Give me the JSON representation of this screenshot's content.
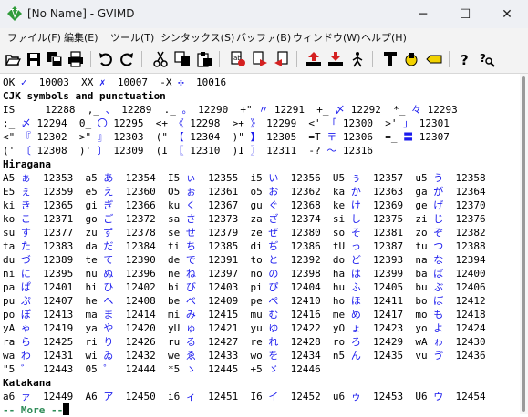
{
  "window": {
    "title": "[No Name] - GVIMD",
    "controls": {
      "minimize": "─",
      "maximize": "☐",
      "close": "✕"
    }
  },
  "menubar": {
    "items": [
      {
        "label": "ファイル(F)"
      },
      {
        "label": "編集(E)"
      },
      {
        "label": "ツール(T)"
      },
      {
        "label": "シンタックス(S)"
      },
      {
        "label": "バッファ(B)"
      },
      {
        "label": "ウィンドウ(W)"
      },
      {
        "label": "ヘルプ(H)"
      }
    ]
  },
  "toolbar": {
    "buttons": [
      {
        "icon": "open-icon"
      },
      {
        "icon": "save-icon"
      },
      {
        "icon": "save-all-icon"
      },
      {
        "icon": "print-icon"
      },
      {
        "icon": "undo-icon"
      },
      {
        "icon": "redo-icon"
      },
      {
        "icon": "cut-icon"
      },
      {
        "icon": "copy-icon"
      },
      {
        "icon": "paste-icon"
      },
      {
        "icon": "replace-icon"
      },
      {
        "icon": "find-next-icon"
      },
      {
        "icon": "find-prev-icon"
      },
      {
        "icon": "load-session-icon"
      },
      {
        "icon": "save-session-icon"
      },
      {
        "icon": "run-script-icon"
      },
      {
        "icon": "make-icon"
      },
      {
        "icon": "shell-icon"
      },
      {
        "icon": "tags-icon"
      },
      {
        "icon": "help-icon"
      },
      {
        "icon": "find-help-icon"
      }
    ]
  },
  "editor": {
    "lines": [
      {
        "kind": "data",
        "text": "OK ✓  10003  XX ✗  10007  -X ✣  10016"
      },
      {
        "kind": "header",
        "text": "CJK symbols and punctuation"
      },
      {
        "kind": "data",
        "text": "IS     12288  ,_ 、 12289  ._ 。 12290  +\" 〃 12291  +_ 〆 12292  *_ 々 12293"
      },
      {
        "kind": "data",
        "text": ";_ 〆 12294  0_ 〇 12295  <+ 《 12298  >+ 》 12299  <' 「 12300  >' 」 12301"
      },
      {
        "kind": "data",
        "text": "<\" 『 12302  >\" 』 12303  (\" 【 12304  )\" 】 12305  =T 〒 12306  =_ 〓 12307"
      },
      {
        "kind": "data",
        "text": "(' 〔 12308  )' 〕 12309  (I 〖 12310  )I 〗 12311  -? 〜 12316"
      },
      {
        "kind": "header",
        "text": "Hiragana"
      },
      {
        "kind": "data",
        "text": "A5 ぁ  12353  a5 あ  12354  I5 ぃ  12355  i5 い  12356  U5 ぅ  12357  u5 う  12358"
      },
      {
        "kind": "data",
        "text": "E5 ぇ  12359  e5 え  12360  O5 ぉ  12361  o5 お  12362  ka か  12363  ga が  12364"
      },
      {
        "kind": "data",
        "text": "ki き  12365  gi ぎ  12366  ku く  12367  gu ぐ  12368  ke け  12369  ge げ  12370"
      },
      {
        "kind": "data",
        "text": "ko こ  12371  go ご  12372  sa さ  12373  za ざ  12374  si し  12375  zi じ  12376"
      },
      {
        "kind": "data",
        "text": "su す  12377  zu ず  12378  se せ  12379  ze ぜ  12380  so そ  12381  zo ぞ  12382"
      },
      {
        "kind": "data",
        "text": "ta た  12383  da だ  12384  ti ち  12385  di ぢ  12386  tU っ  12387  tu つ  12388"
      },
      {
        "kind": "data",
        "text": "du づ  12389  te て  12390  de で  12391  to と  12392  do ど  12393  na な  12394"
      },
      {
        "kind": "data",
        "text": "ni に  12395  nu ぬ  12396  ne ね  12397  no の  12398  ha は  12399  ba ば  12400"
      },
      {
        "kind": "data",
        "text": "pa ぱ  12401  hi ひ  12402  bi び  12403  pi ぴ  12404  hu ふ  12405  bu ぶ  12406"
      },
      {
        "kind": "data",
        "text": "pu ぷ  12407  he へ  12408  be べ  12409  pe ぺ  12410  ho ほ  12411  bo ぼ  12412"
      },
      {
        "kind": "data",
        "text": "po ぽ  12413  ma ま  12414  mi み  12415  mu む  12416  me め  12417  mo も  12418"
      },
      {
        "kind": "data",
        "text": "yA ゃ  12419  ya や  12420  yU ゅ  12421  yu ゆ  12422  yO ょ  12423  yo よ  12424"
      },
      {
        "kind": "data",
        "text": "ra ら  12425  ri り  12426  ru る  12427  re れ  12428  ro ろ  12429  wA ゎ  12430"
      },
      {
        "kind": "data",
        "text": "wa わ  12431  wi ゐ  12432  we ゑ  12433  wo を  12434  n5 ん  12435  vu ゔ  12436"
      },
      {
        "kind": "data",
        "text": "\"5 ゛  12443  05 ゜  12444  *5 ゝ  12445  +5 ゞ  12446"
      },
      {
        "kind": "header",
        "text": "Katakana"
      },
      {
        "kind": "data",
        "text": "a6 ァ  12449  A6 ア  12450  i6 ィ  12451  I6 イ  12452  u6 ゥ  12453  U6 ウ  12454"
      }
    ],
    "more_prompt": "-- More --"
  },
  "colors": {
    "char_blue": "#1a1aee",
    "more_green": "#2e8b57"
  }
}
